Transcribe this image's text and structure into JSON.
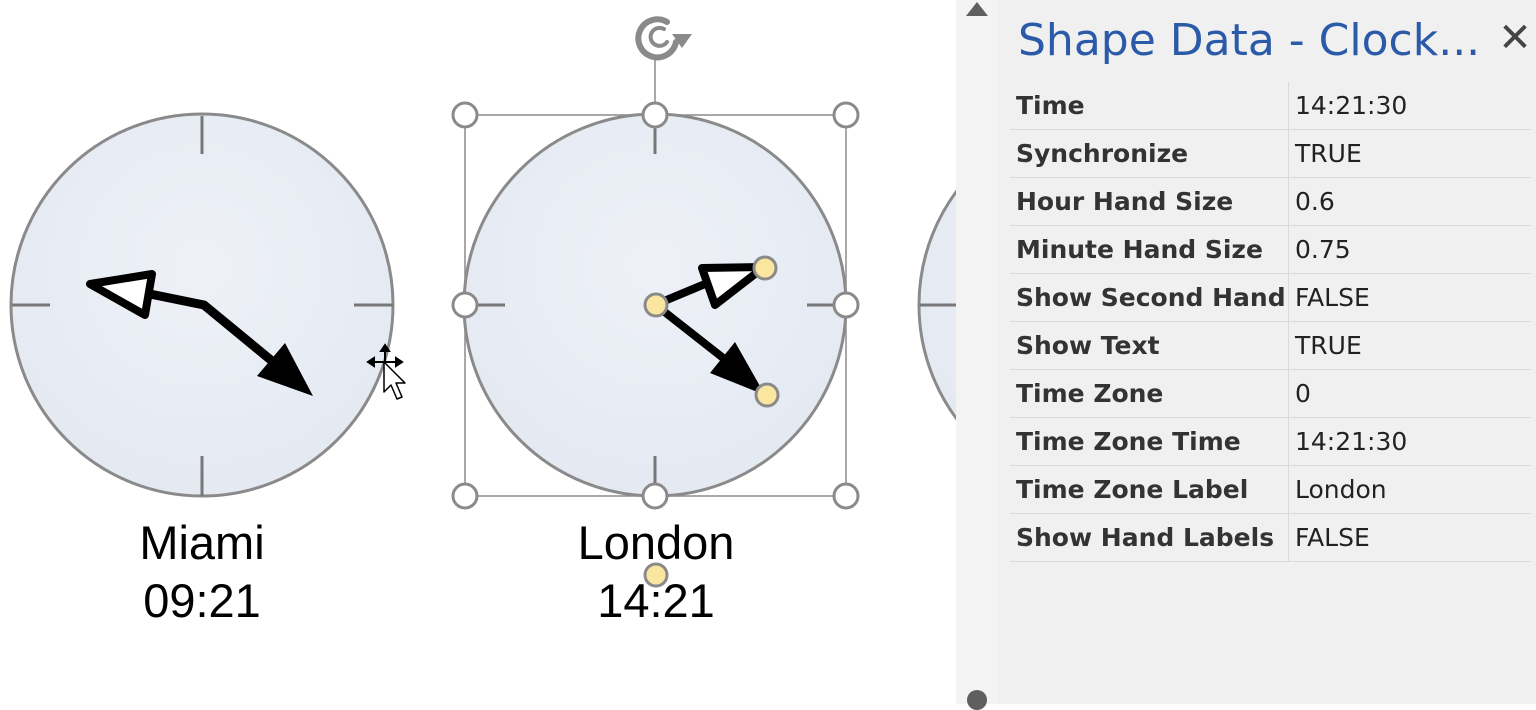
{
  "clocks": [
    {
      "label": "Miami",
      "time": "09:21"
    },
    {
      "label": "London",
      "time": "14:21"
    }
  ],
  "panel": {
    "title": "Shape Data - Clock...",
    "close_glyph": "✕",
    "properties": [
      {
        "name": "Time",
        "value": "14:21:30"
      },
      {
        "name": "Synchronize",
        "value": "TRUE"
      },
      {
        "name": "Hour Hand Size",
        "value": "0.6"
      },
      {
        "name": "Minute Hand Size",
        "value": "0.75"
      },
      {
        "name": "Show Second Hand",
        "value": "FALSE"
      },
      {
        "name": "Show Text",
        "value": "TRUE"
      },
      {
        "name": "Time Zone",
        "value": "0"
      },
      {
        "name": "Time Zone Time",
        "value": "14:21:30"
      },
      {
        "name": "Time Zone Label",
        "value": "London"
      },
      {
        "name": "Show Hand Labels",
        "value": "FALSE"
      }
    ]
  },
  "icons": {
    "rotate": "rotate-handle-icon",
    "cursor": "move-cursor-icon",
    "close": "close-icon"
  },
  "colors": {
    "clock_face": "#e8ecf3",
    "clock_outline": "#8a8a8a",
    "handle_fill": "#fbe6a0",
    "title_blue": "#2b5aa8",
    "panel_bg": "#f0f0f0"
  }
}
